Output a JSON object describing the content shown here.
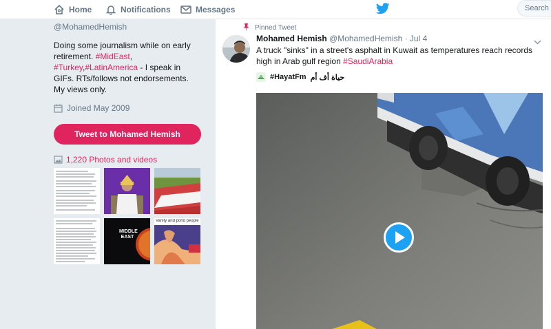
{
  "nav": {
    "home": "Home",
    "notifications": "Notifications",
    "messages": "Messages",
    "search_placeholder": "Search T"
  },
  "profile": {
    "handle": "@MohamedHemish",
    "bio_1": "Doing some journalism while on early retirement. ",
    "bio_tag1": "#MidEast",
    "bio_2": ", ",
    "bio_tag2": "#Turkey",
    "bio_3": ",",
    "bio_tag3": "#LatinAmerica",
    "bio_4": " - I speak in GIFs. RTs/follows not endorsements. My views only.",
    "joined": "Joined May 2009",
    "tweet_button": "Tweet to Mohamed Hemish",
    "photos_link": "1,220 Photos and videos",
    "thumb_captions": {
      "middle_east": "MIDDLE EAST",
      "video_title": "Vanity and pond people"
    }
  },
  "tweet": {
    "pinned_label": "Pinned Tweet",
    "name": "Mohamed Hemish",
    "handle": "@MohamedHemish",
    "separator": " · ",
    "date": "Jul 4",
    "text": "A truck \"sinks\" in a street's asphalt in Kuwait as temperatures reach records high in Arab gulf region ",
    "text_tag": "#SaudiArabia",
    "source_hashtag": "#HayatFm",
    "source_arabic": "حياة أف أم"
  },
  "colors": {
    "accent": "#e0245e",
    "twitter_blue": "#1da1f2",
    "background": "#e6ecf0"
  },
  "icons": {
    "home": "home-icon",
    "notifications": "bell-icon",
    "messages": "envelope-icon",
    "logo": "twitter-bird-icon",
    "calendar": "calendar-icon",
    "photos": "image-icon",
    "pin": "pin-icon",
    "chevron": "chevron-down-icon",
    "play": "play-icon"
  }
}
